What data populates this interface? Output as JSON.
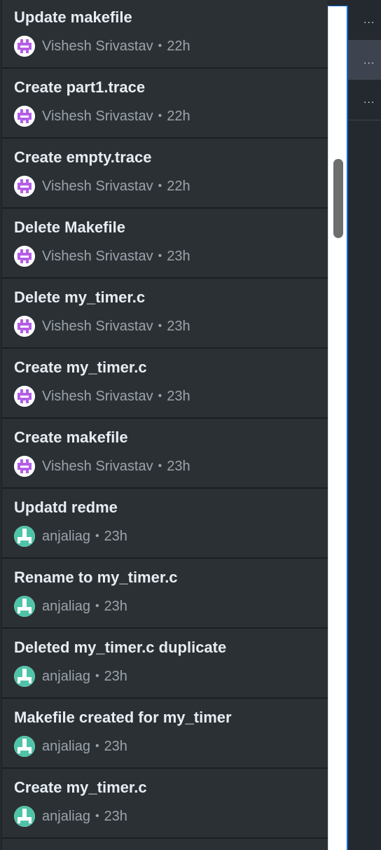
{
  "commits": [
    {
      "message": "Update makefile",
      "author": "Vishesh Srivastav",
      "time": "22h",
      "avatar": "purple-identicon"
    },
    {
      "message": "Create part1.trace",
      "author": "Vishesh Srivastav",
      "time": "22h",
      "avatar": "purple-identicon"
    },
    {
      "message": "Create empty.trace",
      "author": "Vishesh Srivastav",
      "time": "22h",
      "avatar": "purple-identicon"
    },
    {
      "message": "Delete Makefile",
      "author": "Vishesh Srivastav",
      "time": "23h",
      "avatar": "purple-identicon"
    },
    {
      "message": "Delete my_timer.c",
      "author": "Vishesh Srivastav",
      "time": "23h",
      "avatar": "purple-identicon"
    },
    {
      "message": "Create my_timer.c",
      "author": "Vishesh Srivastav",
      "time": "23h",
      "avatar": "purple-identicon"
    },
    {
      "message": "Create makefile",
      "author": "Vishesh Srivastav",
      "time": "23h",
      "avatar": "purple-identicon"
    },
    {
      "message": "Updatd redme",
      "author": "anjaliag",
      "time": "23h",
      "avatar": "teal-identicon"
    },
    {
      "message": "Rename to my_timer.c",
      "author": "anjaliag",
      "time": "23h",
      "avatar": "teal-identicon"
    },
    {
      "message": "Deleted my_timer.c duplicate",
      "author": "anjaliag",
      "time": "23h",
      "avatar": "teal-identicon"
    },
    {
      "message": "Makefile created for my_timer",
      "author": "anjaliag",
      "time": "23h",
      "avatar": "teal-identicon"
    },
    {
      "message": "Create my_timer.c",
      "author": "anjaliag",
      "time": "23h",
      "avatar": "teal-identicon"
    }
  ],
  "separator": "•",
  "right_strip": {
    "rows": [
      "...",
      "...",
      "..."
    ],
    "selected_index": 1
  },
  "colors": {
    "purple_avatar": "#b45de6",
    "teal_avatar": "#4fc3a7",
    "panel_bg": "#2b3035",
    "text_primary": "#e6edf3",
    "text_secondary": "#9ba3ab"
  }
}
